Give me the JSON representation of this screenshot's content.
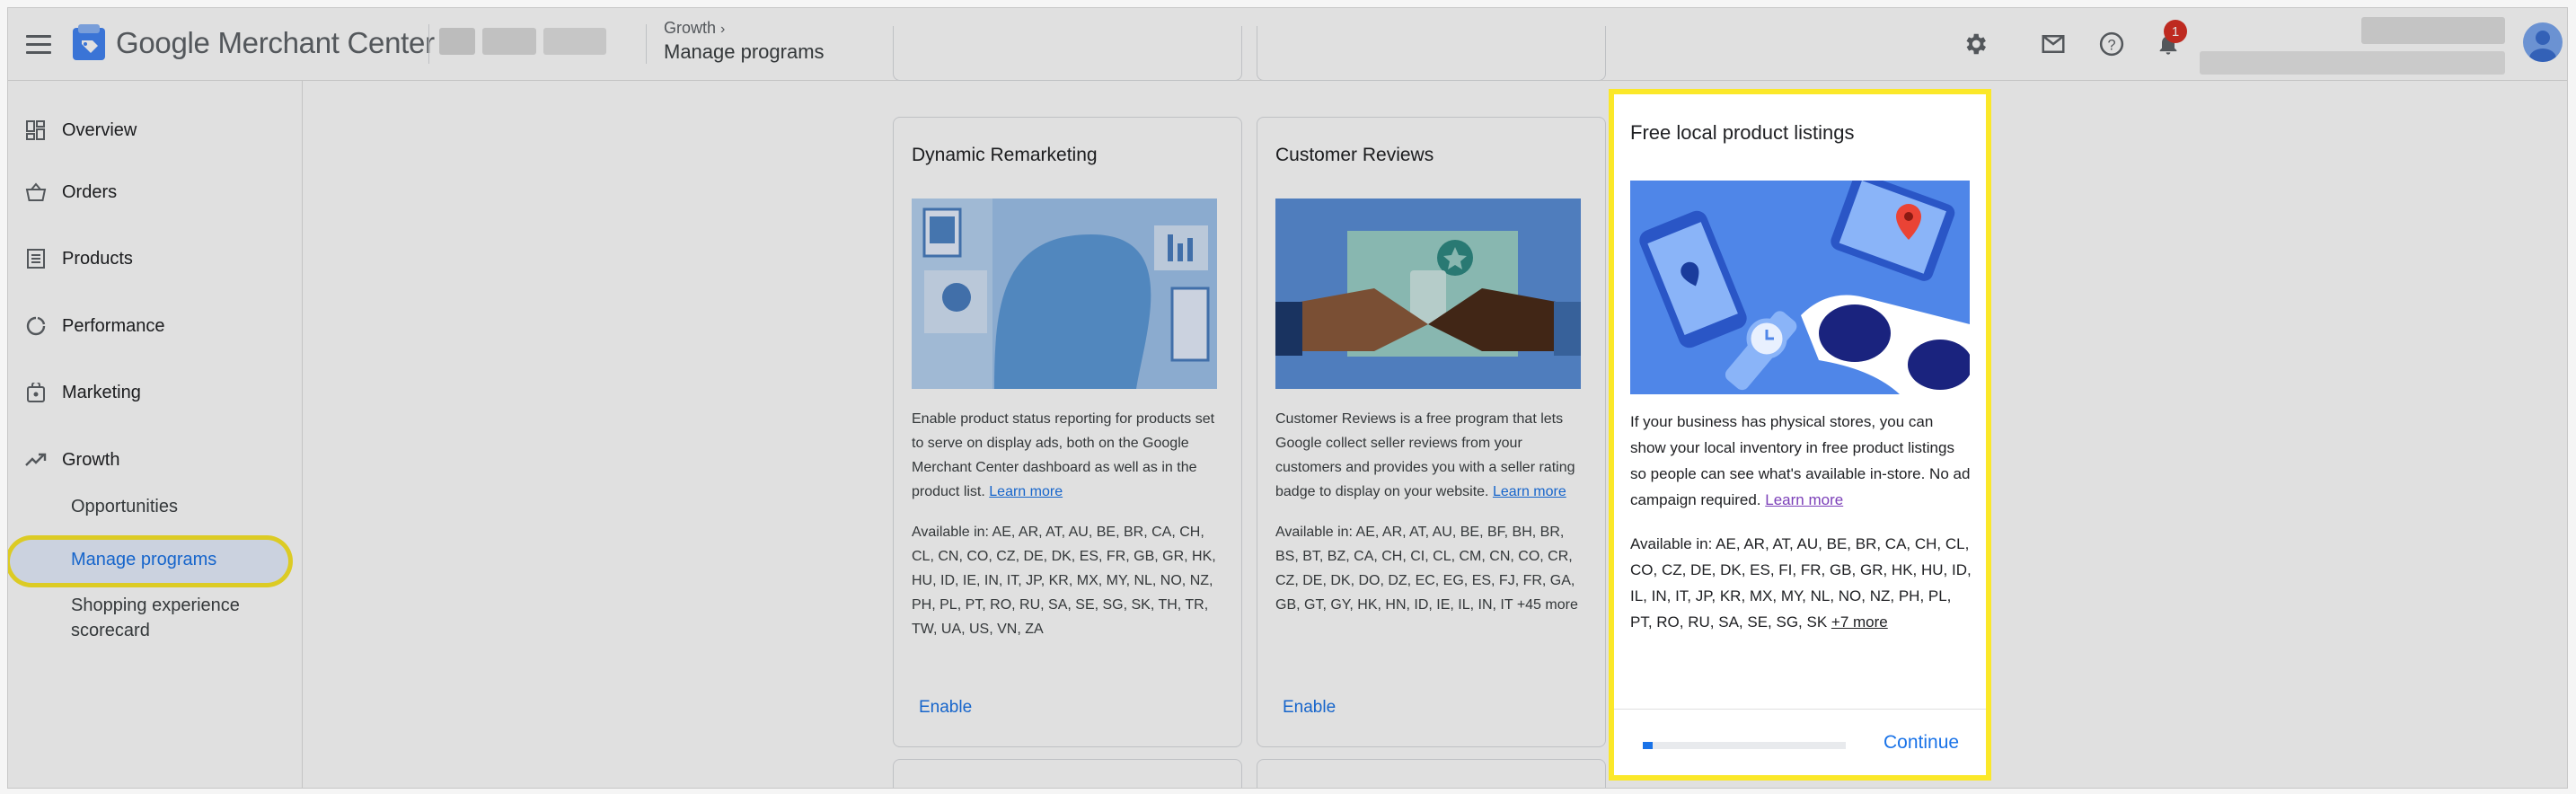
{
  "header": {
    "app_name": "Google Merchant Center",
    "breadcrumb_parent": "Growth",
    "page_title": "Manage programs",
    "notification_count": "1"
  },
  "sidebar": {
    "items": [
      {
        "label": "Overview"
      },
      {
        "label": "Orders"
      },
      {
        "label": "Products"
      },
      {
        "label": "Performance"
      },
      {
        "label": "Marketing"
      },
      {
        "label": "Growth"
      }
    ],
    "growth_sub": [
      {
        "label": "Opportunities"
      },
      {
        "label": "Manage programs"
      },
      {
        "label": "Shopping experience scorecard"
      }
    ]
  },
  "cards": [
    {
      "title": "Dynamic Remarketing",
      "description": "Enable product status reporting for products set to serve on display ads, both on the Google Merchant Center dashboard as well as in the product list.",
      "learn_more": "Learn more",
      "available": "Available in: AE, AR, AT, AU, BE, BR, CA, CH, CL, CN, CO, CZ, DE, DK, ES, FR, GB, GR, HK, HU, ID, IE, IN, IT, JP, KR, MX, MY, NL, NO, NZ, PH, PL, PT, RO, RU, SA, SE, SG, SK, TH, TR, TW, UA, US, VN, ZA",
      "action": "Enable"
    },
    {
      "title": "Customer Reviews",
      "description": "Customer Reviews is a free program that lets Google collect seller reviews from your customers and provides you with a seller rating badge to display on your website.",
      "learn_more": "Learn more",
      "available": "Available in: AE, AR, AT, AU, BE, BF, BH, BR, BS, BT, BZ, CA, CH, CI, CL, CM, CN, CO, CR, CZ, DE, DK, DO, DZ, EC, EG, ES, FJ, FR, GA, GB, GT, GY, HK, HN, ID, IE, IL, IN, IT",
      "more": "+45 more",
      "action": "Enable"
    }
  ],
  "panel": {
    "title": "Free local product listings",
    "description": "If your business has physical stores, you can show your local inventory in free product listings so people can see what's available in-store. No ad campaign required.",
    "learn_more": "Learn more",
    "available": "Available in: AE, AR, AT, AU, BE, BR, CA, CH, CL, CO, CZ, DE, DK, ES, FI, FR, GB, GR, HK, HU, ID, IL, IN, IT, JP, KR, MX, MY, NL, NO, NZ, PH, PL, PT, RO, RU, SA, SE, SG, SK",
    "more": "+7 more",
    "progress": 0.05,
    "continue": "Continue"
  },
  "colors": {
    "accent": "#1a73e8",
    "highlight": "#fbe829",
    "badge": "#d93025"
  },
  "icons": [
    "menu-icon",
    "merchant-center-logo",
    "settings-icon",
    "mail-icon",
    "help-icon",
    "notifications-icon",
    "overview-icon",
    "orders-icon",
    "products-icon",
    "performance-icon",
    "marketing-icon",
    "growth-icon"
  ]
}
